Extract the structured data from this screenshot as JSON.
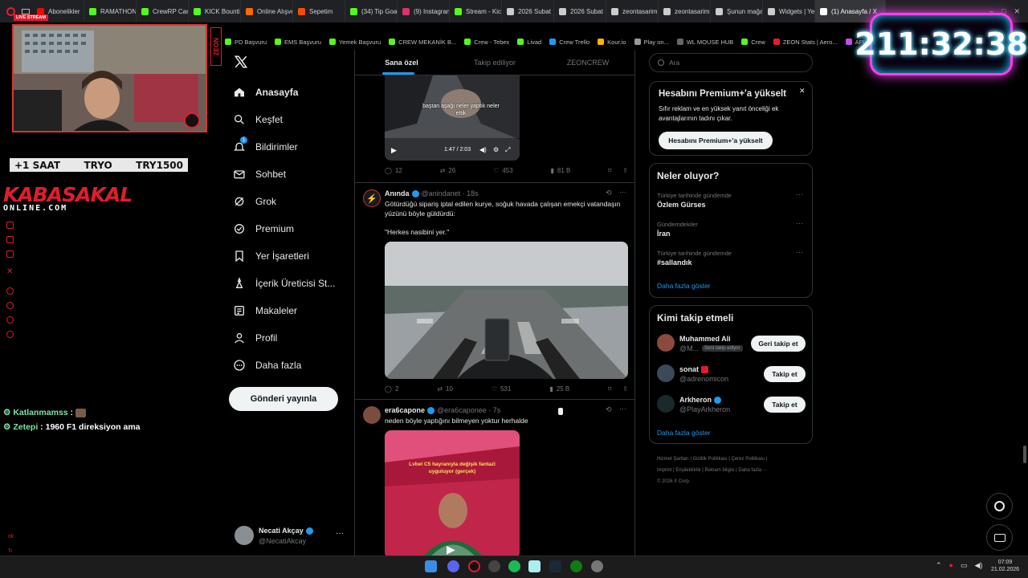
{
  "browser": {
    "tabs": [
      {
        "label": "Abonelikler",
        "color": "#ff0000"
      },
      {
        "label": "RAMATHON",
        "color": "#53fc18"
      },
      {
        "label": "CrewRP Car",
        "color": "#53fc18"
      },
      {
        "label": "KICK Bountie",
        "color": "#53fc18"
      },
      {
        "label": "Online Alışve",
        "color": "#ff6a00"
      },
      {
        "label": "Sepetim",
        "color": "#ff4b00"
      },
      {
        "label": "(34) Tip Goal",
        "color": "#53fc18"
      },
      {
        "label": "(9) Instagram",
        "color": "#e1306c"
      },
      {
        "label": "Stream - Kick",
        "color": "#53fc18"
      },
      {
        "label": "2026 Subat",
        "color": "#cccccc"
      },
      {
        "label": "2026 Subat",
        "color": "#cccccc"
      },
      {
        "label": "zeontasarim",
        "color": "#cccccc"
      },
      {
        "label": "zeontasarim",
        "color": "#cccccc"
      },
      {
        "label": "Şunun mağa",
        "color": "#cccccc"
      },
      {
        "label": "Widgets | Ye",
        "color": "#cccccc"
      },
      {
        "label": "(1) Anasayfa / X",
        "color": "#ffffff",
        "active": true
      }
    ],
    "bookmarks": [
      "PD Başvuru",
      "EMS Başvuru",
      "Yemek Başvuru",
      "CREW MEKANİK B...",
      "Crew - Tebex",
      "Livad",
      "Crew Trello",
      "Kour.io",
      "Play on...",
      "WL MOUSE HUB",
      "Crew",
      "ZEON Stats | Aero...",
      "APIq"
    ]
  },
  "stream": {
    "live_label": "LIVE STREAM",
    "side_logo": "ZEON",
    "badge": [
      "+1 SAAT",
      "TRYO",
      "TRY1500"
    ],
    "logo_top": "KABASAKAL",
    "logo_bottom": "ONLINE.COM",
    "chat": [
      {
        "user": "Katlanmamss",
        "text": ""
      },
      {
        "user": "Zetepi",
        "text": "1960 F1 direksiyon ama"
      }
    ],
    "timer": "211:32:38"
  },
  "sidebar": {
    "items": [
      {
        "label": "Anasayfa",
        "icon": "home-icon",
        "bold": true
      },
      {
        "label": "Keşfet",
        "icon": "search-icon"
      },
      {
        "label": "Bildirimler",
        "icon": "bell-icon",
        "badge": "1"
      },
      {
        "label": "Sohbet",
        "icon": "mail-icon"
      },
      {
        "label": "Grok",
        "icon": "grok-icon"
      },
      {
        "label": "Premium",
        "icon": "x-premium-icon"
      },
      {
        "label": "Yer İşaretleri",
        "icon": "bookmark-icon"
      },
      {
        "label": "İçerik Üreticisi St...",
        "icon": "creator-icon"
      },
      {
        "label": "Makaleler",
        "icon": "article-icon"
      },
      {
        "label": "Profil",
        "icon": "profile-icon"
      },
      {
        "label": "Daha fazla",
        "icon": "more-icon"
      }
    ],
    "post_button": "Gönderi yayınla",
    "account": {
      "name": "Necati Akçay",
      "handle": "@NecatiAkcay"
    }
  },
  "feed": {
    "tabs": [
      "Sana özel",
      "Takip ediliyor",
      "ZEONCREW"
    ],
    "tweet1": {
      "caption": "baştan aşağı neler yaptık neler ettik",
      "time": "1:47 / 2:03",
      "replies": "12",
      "reposts": "26",
      "likes": "453",
      "views": "81 B"
    },
    "tweet2": {
      "name": "Anında",
      "handle": "@anindanet · 18s",
      "text1": "Götürdüğü sipariş iptal edilen kurye, soğuk havada çalışan emekçi vatandaşın yüzünü böyle güldürdü:",
      "text2": "\"Herkes nasibini yer.\"",
      "replies": "2",
      "reposts": "10",
      "likes": "531",
      "views": "25 B"
    },
    "tweet3": {
      "name": "era6capone",
      "handle": "@era6caponee · 7s",
      "text": "neden böyle yaptığını bilmeyen yoktur herhalde",
      "caption": "Lvbel C5 hayranıyla değişik fantazi uyguluyor (gerçek)"
    }
  },
  "right": {
    "search_placeholder": "Ara",
    "premium": {
      "title": "Hesabını Premium+'a yükselt",
      "text": "Sıfır reklam ve en yüksek yanıt önceliği ek avantajlarının tadını çıkar.",
      "button": "Hesabını Premium+'a yükselt"
    },
    "trends": {
      "title": "Neler oluyor?",
      "items": [
        {
          "context": "Türkiye tarihinde gündemde",
          "topic": "Özlem Gürses"
        },
        {
          "context": "Gündemdekiler",
          "topic": "İran"
        },
        {
          "context": "Türkiye tarihinde gündemde",
          "topic": "#sallandık"
        }
      ],
      "more": "Daha fazla göster"
    },
    "who": {
      "title": "Kimi takip etmeli",
      "items": [
        {
          "name": "Muhammed Ali",
          "handle": "@M...",
          "tag": "Seni takip ediyor",
          "button": "Geri takip et"
        },
        {
          "name": "sonat",
          "handle": "@adrenomicon",
          "button": "Takip et"
        },
        {
          "name": "Arkheron",
          "handle": "@PlayArkheron",
          "button": "Takip et"
        }
      ],
      "more": "Daha fazla göster"
    },
    "footer": [
      "Hizmet Şartları",
      "Gizlilik Politikası",
      "Çerez Politikası",
      "Imprint",
      "Erişilebilirlik",
      "Reklam bilgisi",
      "Daha fazla ···",
      "© 2026 X Corp."
    ]
  },
  "taskbar": {
    "time": "07:09",
    "date": "21.02.2026"
  }
}
